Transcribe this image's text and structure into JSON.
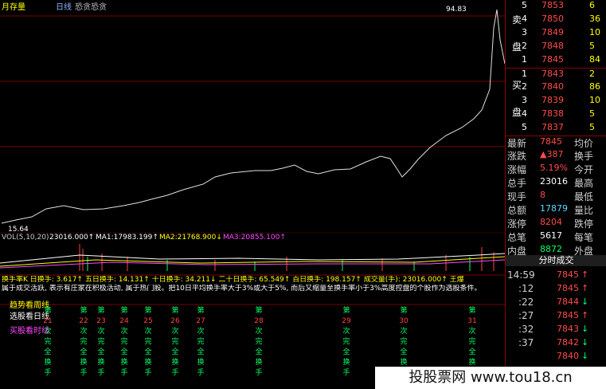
{
  "header": {
    "title": "月存量",
    "tab1": "日线",
    "tab2": "恐贪恐贪"
  },
  "chart": {
    "price_high": "94.83",
    "price_low": "15.64"
  },
  "volume": {
    "label": "VOL(5,10,20)",
    "value": "23016.000↑",
    "ma1": "MA1:17983.199↑",
    "ma2": "MA2:21768.900↓",
    "ma3": "MA3:20855.100↑"
  },
  "turnover": {
    "text": "换手率K 日换手: 3.617↑ 五日换手: 14.131↑ 十日换手: 34.211↓ 二十日换手: 65.549↑ 百日换手: 198.157↑ 成交量(手): 23016.000↑ 王爆",
    "explain": "属于成交活跃, 表示有庄家在积极活动, 属于热门股。把10日平均换手率大于3%或大于5%, 而后又缩量至换手率小于3%高度控盘的个股作为选股条件。"
  },
  "bottom": {
    "label1": "趋势看周线",
    "label2": "选股看日线",
    "label3": "买股看时线",
    "cols": [
      {
        "n": "21",
        "t": [
          "次",
          "完",
          "全",
          "换",
          "手"
        ]
      },
      {
        "n": "22",
        "t": [
          "次",
          "完",
          "全",
          "换",
          "手"
        ]
      },
      {
        "n": "23",
        "t": [
          "次",
          "完",
          "全",
          "换",
          "手"
        ]
      },
      {
        "n": "24",
        "t": [
          "次",
          "完",
          "全",
          "换",
          "手"
        ]
      },
      {
        "n": "25",
        "t": [
          "次",
          "完",
          "全",
          "换",
          "手"
        ]
      },
      {
        "n": "26",
        "t": [
          "次",
          "完",
          "全",
          "换",
          "手"
        ]
      },
      {
        "n": "27",
        "t": [
          "次",
          "完",
          "全",
          "换",
          "手"
        ]
      },
      {
        "n": "28",
        "t": [
          "次",
          "完",
          "全",
          "换",
          "手"
        ]
      },
      {
        "n": "29",
        "t": [
          "次",
          "完",
          "全",
          "换",
          "手"
        ]
      },
      {
        "n": "30",
        "t": [
          "次",
          "完",
          "全",
          "换",
          "手"
        ]
      },
      {
        "n": "31",
        "t": [
          "次",
          "完",
          "全",
          "换",
          "手"
        ]
      }
    ],
    "top": "第"
  },
  "sell": {
    "label_a": "卖",
    "label_b": "盘",
    "rows": [
      {
        "lvl": "5",
        "price": "7853",
        "vol": "6"
      },
      {
        "lvl": "4",
        "price": "7850",
        "vol": "36"
      },
      {
        "lvl": "3",
        "price": "7849",
        "vol": "10"
      },
      {
        "lvl": "2",
        "price": "7848",
        "vol": "5"
      },
      {
        "lvl": "1",
        "price": "7845",
        "vol": "84"
      }
    ]
  },
  "buy": {
    "label_a": "买",
    "label_b": "盘",
    "rows": [
      {
        "lvl": "1",
        "price": "7843",
        "vol": "2"
      },
      {
        "lvl": "2",
        "price": "7840",
        "vol": "86"
      },
      {
        "lvl": "3",
        "price": "7839",
        "vol": "10"
      },
      {
        "lvl": "4",
        "price": "7838",
        "vol": "5"
      },
      {
        "lvl": "5",
        "price": "7837",
        "vol": "5"
      }
    ]
  },
  "quote": [
    {
      "l1": "最新",
      "v1": "7845",
      "l2": "均价",
      "v2": ""
    },
    {
      "l1": "涨跌",
      "v1": "▲387",
      "l2": "换手",
      "v2": ""
    },
    {
      "l1": "涨幅",
      "v1": "5.19%",
      "l2": "今开",
      "v2": ""
    },
    {
      "l1": "总手",
      "v1": "23016",
      "l2": "最高",
      "v2": ""
    },
    {
      "l1": "现手",
      "v1": "8",
      "l2": "最低",
      "v2": ""
    },
    {
      "l1": "总额",
      "v1": "17879",
      "l2": "量比",
      "v2": ""
    },
    {
      "l1": "涨停",
      "v1": "8204",
      "l2": "跌停",
      "v2": ""
    },
    {
      "l1": "总笔",
      "v1": "5617",
      "l2": "每笔",
      "v2": ""
    },
    {
      "l1": "内盘",
      "v1": "8872",
      "l2": "外盘",
      "v2": ""
    }
  ],
  "ticks_title": "分时成交",
  "ticks": [
    {
      "t": "14:59",
      "p": "7845",
      "a": "↑"
    },
    {
      "t": ":12",
      "p": "7845",
      "a": "↑"
    },
    {
      "t": ":22",
      "p": "7844",
      "a": "↓"
    },
    {
      "t": ":27",
      "p": "7845",
      "a": "↑"
    },
    {
      "t": ":32",
      "p": "7843",
      "a": "↓"
    },
    {
      "t": ":37",
      "p": "7842",
      "a": "↓"
    },
    {
      "t": "",
      "p": "7840",
      "a": "↓"
    }
  ],
  "watermark": "投股票网 www.tou18.cn"
}
